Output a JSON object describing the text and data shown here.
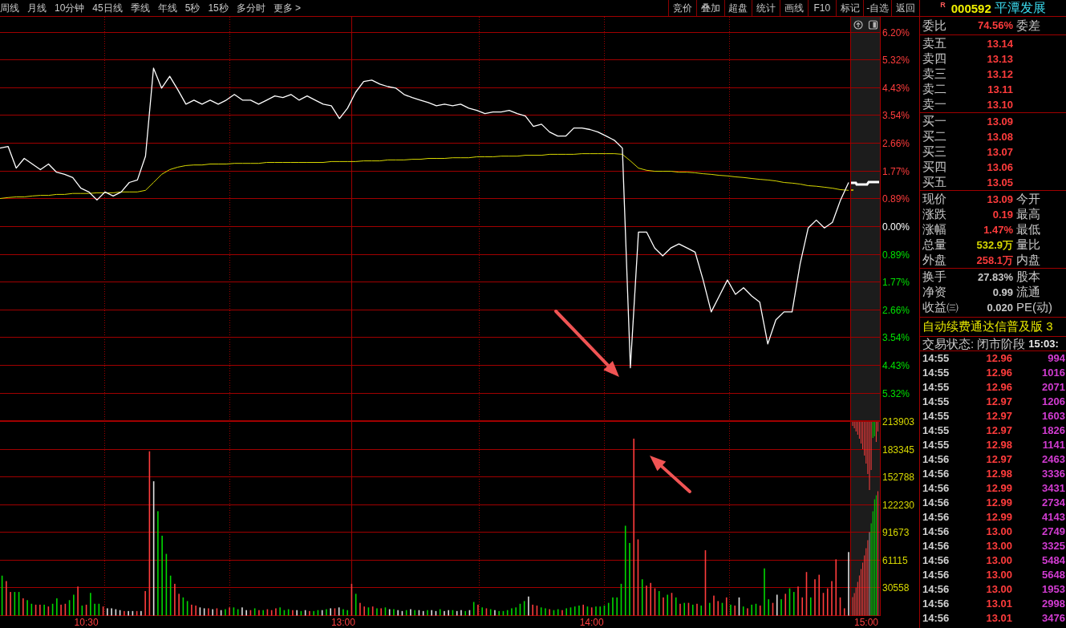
{
  "toolbar": {
    "periods": [
      "周线",
      "月线",
      "10分钟",
      "45日线",
      "季线",
      "年线",
      "5秒",
      "15秒",
      "多分时",
      "更多 >"
    ],
    "buttons": [
      "竞价",
      "叠加",
      "超盘",
      "统计",
      "画线",
      "F10",
      "标记",
      "-自选",
      "返回"
    ]
  },
  "quote_header": {
    "badge": "R",
    "code": "000592",
    "name": "平潭发展"
  },
  "chart": {
    "chart_data": [
      {
        "type": "line",
        "grid": true,
        "tick_labels": "y",
        "ylim": [
          -6.2,
          6.2
        ],
        "yticks": [
          {
            "value": 6.2,
            "label": "6.20%"
          },
          {
            "value": 5.32,
            "label": "5.32%"
          },
          {
            "value": 4.43,
            "label": "4.43%"
          },
          {
            "value": 3.54,
            "label": "3.54%"
          },
          {
            "value": 2.66,
            "label": "2.66%"
          },
          {
            "value": 1.77,
            "label": "1.77%"
          },
          {
            "value": 0.89,
            "label": "0.89%"
          },
          {
            "value": 0,
            "label": "0.00%"
          },
          {
            "value": -0.89,
            "label": "0.89%"
          },
          {
            "value": -1.77,
            "label": "1.77%"
          },
          {
            "value": -2.66,
            "label": "2.66%"
          },
          {
            "value": -3.54,
            "label": "3.54%"
          },
          {
            "value": -4.43,
            "label": "4.43%"
          },
          {
            "value": -5.32,
            "label": "5.32%"
          }
        ],
        "series": [
          {
            "color": "#ffffff",
            "values": [
              2.5,
              2.55,
              1.86,
              2.17,
              1.99,
              1.81,
              1.99,
              1.73,
              1.66,
              1.56,
              1.22,
              1.1,
              0.84,
              1.1,
              0.97,
              1.1,
              1.4,
              1.48,
              2.24,
              5.05,
              4.41,
              4.79,
              4.36,
              3.9,
              4.03,
              3.9,
              4.03,
              3.9,
              4.03,
              4.21,
              4.03,
              4.03,
              3.9,
              4.03,
              4.16,
              4.11,
              4.21,
              4.03,
              4.16,
              4.03,
              3.9,
              3.85,
              3.44,
              3.77,
              4.28,
              4.62,
              4.67,
              4.54,
              4.46,
              4.41,
              4.21,
              4.11,
              4.03,
              3.95,
              3.85,
              3.9,
              3.85,
              3.9,
              3.77,
              3.7,
              3.6,
              3.65,
              3.65,
              3.7,
              3.6,
              3.52,
              3.19,
              3.26,
              3.01,
              2.88,
              2.88,
              3.14,
              3.14,
              3.09,
              3.01,
              2.88,
              2.75,
              2.5,
              -4.51,
              -0.18,
              -0.18,
              -0.69,
              -0.94,
              -0.69,
              -0.56,
              -0.69,
              -0.82,
              -1.71,
              -2.73,
              -2.22,
              -1.71,
              -2.17,
              -1.96,
              -2.22,
              -2.42,
              -3.75,
              -2.98,
              -2.73,
              -2.73,
              -1.2,
              -0.05,
              0.2,
              -0.05,
              0.13,
              0.84,
              1.4
            ]
          },
          {
            "color": "#d8d800",
            "values": [
              0.89,
              0.92,
              0.94,
              0.94,
              0.97,
              0.99,
              0.99,
              1.02,
              1.02,
              1.05,
              1.05,
              1.05,
              1.07,
              1.07,
              1.07,
              1.1,
              1.1,
              1.1,
              1.15,
              1.4,
              1.66,
              1.81,
              1.89,
              1.94,
              1.96,
              1.96,
              1.99,
              1.99,
              1.99,
              2.01,
              2.01,
              2.01,
              2.01,
              2.04,
              2.04,
              2.04,
              2.04,
              2.04,
              2.04,
              2.04,
              2.04,
              2.07,
              2.07,
              2.07,
              2.07,
              2.09,
              2.09,
              2.09,
              2.12,
              2.12,
              2.12,
              2.14,
              2.14,
              2.17,
              2.17,
              2.17,
              2.19,
              2.19,
              2.19,
              2.22,
              2.22,
              2.22,
              2.24,
              2.24,
              2.24,
              2.27,
              2.27,
              2.27,
              2.3,
              2.3,
              2.3,
              2.3,
              2.32,
              2.32,
              2.32,
              2.32,
              2.32,
              2.3,
              2.09,
              1.86,
              1.79,
              1.76,
              1.76,
              1.76,
              1.73,
              1.73,
              1.71,
              1.68,
              1.66,
              1.63,
              1.61,
              1.58,
              1.56,
              1.53,
              1.5,
              1.48,
              1.45,
              1.4,
              1.38,
              1.35,
              1.3,
              1.28,
              1.25,
              1.22,
              1.17,
              1.15
            ]
          }
        ]
      },
      {
        "type": "bar",
        "grid": true,
        "ylim": [
          0,
          213903
        ],
        "yticks": [
          213903,
          183345,
          152788,
          122230,
          91673,
          61115,
          30558
        ],
        "categories": [
          null,
          null,
          null,
          null,
          null,
          null,
          null,
          null,
          null,
          null,
          null,
          null,
          null,
          null,
          null,
          null,
          null,
          null,
          null,
          null,
          "10:30",
          null,
          null,
          null,
          null,
          null,
          null,
          null,
          null,
          null,
          null,
          null,
          null,
          null,
          null,
          null,
          null,
          null,
          null,
          null,
          null,
          null,
          null,
          null,
          null,
          null,
          null,
          null,
          null,
          null,
          null,
          null,
          null,
          null,
          null,
          null,
          null,
          null,
          null,
          null,
          null,
          null,
          null,
          null,
          null,
          null,
          null,
          null,
          null,
          null,
          null,
          null,
          null,
          null,
          null,
          null,
          null,
          null,
          null,
          null,
          null,
          "13:00",
          null,
          null,
          null,
          null,
          null,
          null,
          null,
          null,
          null,
          null,
          null,
          null,
          null,
          null,
          null,
          null,
          null,
          null,
          null,
          null,
          null,
          null,
          null,
          null,
          null,
          null,
          null,
          null,
          null,
          null,
          null,
          null,
          null,
          null,
          null,
          null,
          null,
          null,
          null,
          null,
          null,
          null,
          null,
          null,
          null,
          null,
          null,
          null,
          null,
          null,
          null,
          null,
          null,
          null,
          null,
          null,
          null,
          null,
          "14:00",
          null,
          null,
          null,
          null,
          null,
          null,
          null,
          null,
          null,
          null,
          null,
          null,
          null,
          null,
          null,
          null,
          null,
          null,
          null,
          null,
          null,
          null,
          null,
          null,
          null,
          null,
          null,
          null,
          null,
          null,
          null,
          null,
          null,
          null,
          null,
          null,
          null,
          null,
          null,
          null,
          null,
          null,
          null,
          null,
          null,
          null,
          null,
          null,
          null,
          null,
          null,
          null,
          null,
          null,
          null,
          null,
          null,
          null,
          null,
          null,
          null
        ],
        "values": [
          44000,
          38000,
          26000,
          26000,
          26000,
          19000,
          17000,
          13000,
          12000,
          12000,
          12000,
          10000,
          13000,
          19000,
          12000,
          13000,
          17000,
          23000,
          32000,
          11000,
          12000,
          25000,
          13000,
          13000,
          10000,
          8000,
          8000,
          7000,
          6000,
          5000,
          5000,
          5000,
          5000,
          5000,
          27000,
          181000,
          148000,
          115000,
          88000,
          68000,
          44000,
          35000,
          24000,
          20000,
          16000,
          12000,
          11000,
          9000,
          8000,
          8000,
          7000,
          8000,
          6000,
          7000,
          9000,
          9000,
          7000,
          9000,
          6000,
          6000,
          8000,
          6000,
          6000,
          7000,
          6000,
          8000,
          9000,
          6000,
          7000,
          6000,
          6000,
          5000,
          6000,
          5000,
          5000,
          6000,
          6000,
          7000,
          8000,
          8000,
          9000,
          7000,
          6000,
          35000,
          24000,
          14000,
          10000,
          9000,
          10000,
          8000,
          8000,
          9000,
          7000,
          7000,
          6000,
          5000,
          6000,
          7000,
          6000,
          6000,
          5000,
          6000,
          6000,
          5000,
          7000,
          5000,
          6000,
          6000,
          5000,
          6000,
          5000,
          6000,
          15000,
          12000,
          9000,
          8000,
          7000,
          6000,
          5000,
          5000,
          6000,
          8000,
          9000,
          13000,
          16000,
          21000,
          12000,
          11000,
          9000,
          8000,
          7000,
          6000,
          7000,
          6000,
          8000,
          9000,
          10000,
          11000,
          12000,
          10000,
          9000,
          10000,
          10000,
          11000,
          14000,
          20000,
          20000,
          35000,
          99000,
          80000,
          195000,
          84000,
          40000,
          33000,
          36000,
          30000,
          27000,
          20000,
          23000,
          25000,
          20000,
          13000,
          14000,
          14000,
          12000,
          13000,
          11000,
          72000,
          14000,
          22000,
          16000,
          14000,
          20000,
          12000,
          11000,
          20000,
          10000,
          8000,
          12000,
          13000,
          11000,
          52000,
          18000,
          14000,
          23000,
          18000,
          24000,
          30000,
          26000,
          32000,
          20000,
          48000,
          20000,
          40000,
          45000,
          25000,
          30000,
          38000,
          62000,
          20000,
          8000,
          70000
        ],
        "colors": [
          "#00d800",
          "#ff3c3c",
          "#ff3c3c",
          "#00d800",
          "#00d800",
          "#ff3c3c",
          "#00d800",
          "#00d800",
          "#ff3c3c",
          "#ff3c3c",
          "#00d800",
          "#ff3c3c",
          "#00d800",
          "#00d800",
          "#ff3c3c",
          "#ff3c3c",
          "#00d800",
          "#00d800",
          "#ff3c3c",
          "#00d800",
          "#ff3c3c",
          "#00d800",
          "#00d800",
          "#00d800",
          "#ff3c3c",
          "#e0e0e0",
          "#e0e0e0",
          "#e0e0e0",
          "#e0e0e0",
          "#ff3c3c",
          "#e0e0e0",
          "#e0e0e0",
          "#ff3c3c",
          "#e0e0e0",
          "#ff3c3c",
          "#ff3c3c",
          "#e0e0e0",
          "#00d800",
          "#00d800",
          "#00d800",
          "#00d800",
          "#ff3c3c",
          "#ff3c3c",
          "#00d800",
          "#00d800",
          "#ff3c3c",
          "#ff3c3c",
          "#e0e0e0",
          "#e0e0e0",
          "#ff3c3c",
          "#e0e0e0",
          "#ff3c3c",
          "#e0e0e0",
          "#00d800",
          "#ff3c3c",
          "#00d800",
          "#00d800",
          "#e0e0e0",
          "#e0e0e0",
          "#ff3c3c",
          "#00d800",
          "#ff3c3c",
          "#00d800",
          "#ff3c3c",
          "#ff3c3c",
          "#ff3c3c",
          "#00d800",
          "#00d800",
          "#00d800",
          "#ff3c3c",
          "#e0e0e0",
          "#00d800",
          "#e0e0e0",
          "#ff3c3c",
          "#00d800",
          "#00d800",
          "#e0e0e0",
          "#00d800",
          "#e0e0e0",
          "#ff3c3c",
          "#e0e0e0",
          "#00d800",
          "#00d800",
          "#ff3c3c",
          "#00d800",
          "#ff3c3c",
          "#ff3c3c",
          "#00d800",
          "#ff3c3c",
          "#00d800",
          "#ff3c3c",
          "#00d800",
          "#e0e0e0",
          "#00d800",
          "#e0e0e0",
          "#e0e0e0",
          "#00d800",
          "#e0e0e0",
          "#00d800",
          "#e0e0e0",
          "#e0e0e0",
          "#00d800",
          "#e0e0e0",
          "#e0e0e0",
          "#00d800",
          "#e0e0e0",
          "#e0e0e0",
          "#00d800",
          "#e0e0e0",
          "#e0e0e0",
          "#00d800",
          "#e0e0e0",
          "#00d800",
          "#ff3c3c",
          "#00d800",
          "#ff3c3c",
          "#00d800",
          "#e0e0e0",
          "#00d800",
          "#00d800",
          "#00d800",
          "#00d800",
          "#00d800",
          "#00d800",
          "#00d800",
          "#e0e0e0",
          "#ff3c3c",
          "#ff3c3c",
          "#00d800",
          "#00d800",
          "#ff3c3c",
          "#00d800",
          "#00d800",
          "#ff3c3c",
          "#00d800",
          "#00d800",
          "#00d800",
          "#00d800",
          "#ff3c3c",
          "#00d800",
          "#ff3c3c",
          "#00d800",
          "#00d800",
          "#00d800",
          "#00d800",
          "#00d800",
          "#00d800",
          "#00d800",
          "#00d800",
          "#00d800",
          "#ff3c3c",
          "#ff3c3c",
          "#00d800",
          "#ff3c3c",
          "#ff3c3c",
          "#ff3c3c",
          "#00d800",
          "#ff3c3c",
          "#00d800",
          "#ff3c3c",
          "#00d800",
          "#ff3c3c",
          "#00d800",
          "#ff3c3c",
          "#00d800",
          "#ff3c3c",
          "#00d800",
          "#ff3c3c",
          "#00d800",
          "#ff3c3c",
          "#ff3c3c",
          "#00d800",
          "#ff3c3c",
          "#00d800",
          "#ff3c3c",
          "#e0e0e0",
          "#00d800",
          "#ff3c3c",
          "#00d800",
          "#00d800",
          "#ff3c3c",
          "#00d800",
          "#00d800",
          "#ff3c3c",
          "#e0e0e0",
          "#00d800",
          "#ff3c3c",
          "#00d800",
          "#00d800",
          "#ff3c3c",
          "#ff3c3c",
          "#ff3c3c",
          "#00d800",
          "#ff3c3c",
          "#ff3c3c",
          "#ff3c3c",
          "#ff3c3c",
          "#ff3c3c",
          "#ff3c3c",
          "#ff3c3c",
          "#ff3c3c",
          "#e0e0e0"
        ]
      }
    ],
    "end_time_label": "15:00"
  },
  "quote_panel": {
    "order_ratio": {
      "label": "委比",
      "value": "74.56%",
      "label_2": "委差"
    },
    "asks": [
      {
        "label": "卖五",
        "price": "13.14"
      },
      {
        "label": "卖四",
        "price": "13.13"
      },
      {
        "label": "卖三",
        "price": "13.12"
      },
      {
        "label": "卖二",
        "price": "13.11"
      },
      {
        "label": "卖一",
        "price": "13.10"
      }
    ],
    "bids": [
      {
        "label": "买一",
        "price": "13.09"
      },
      {
        "label": "买二",
        "price": "13.08"
      },
      {
        "label": "买三",
        "price": "13.07"
      },
      {
        "label": "买四",
        "price": "13.06"
      },
      {
        "label": "买五",
        "price": "13.05"
      }
    ],
    "stats": [
      [
        {
          "label": "现价",
          "value": "13.09",
          "color": "#ff3c3c",
          "label_2": "今开"
        },
        {
          "label": "涨跌",
          "value": "0.19",
          "color": "#ff3c3c",
          "label_2": "最高"
        },
        {
          "label": "涨幅",
          "value": "1.47%",
          "color": "#ff3c3c",
          "label_2": "最低"
        },
        {
          "label": "总量",
          "value": "532.9万",
          "color": "#d8d800",
          "label_2": "量比"
        },
        {
          "label": "外盘",
          "value": "258.1万",
          "color": "#ff3c3c",
          "label_2": "内盘"
        }
      ],
      [
        {
          "label": "换手",
          "value": "27.83%",
          "color": "#c8c8c8",
          "label_2": "股本"
        },
        {
          "label": "净资",
          "value": "0.99",
          "color": "#c8c8c8",
          "label_2": "流通"
        },
        {
          "label": "收益㈢",
          "value": "0.020",
          "color": "#c8c8c8",
          "label_2": "PE(动)"
        }
      ]
    ],
    "promo": "自动续费通达信普及版 3",
    "trade_status": {
      "label": "交易状态:",
      "value": "闭市阶段",
      "time": "15:03:"
    },
    "ticks": [
      {
        "time": "14:55",
        "price": "12.96",
        "volume": "994"
      },
      {
        "time": "14:55",
        "price": "12.96",
        "volume": "1016"
      },
      {
        "time": "14:55",
        "price": "12.96",
        "volume": "2071"
      },
      {
        "time": "14:55",
        "price": "12.97",
        "volume": "1206"
      },
      {
        "time": "14:55",
        "price": "12.97",
        "volume": "1603"
      },
      {
        "time": "14:55",
        "price": "12.97",
        "volume": "1826"
      },
      {
        "time": "14:55",
        "price": "12.98",
        "volume": "1141"
      },
      {
        "time": "14:56",
        "price": "12.97",
        "volume": "2463"
      },
      {
        "time": "14:56",
        "price": "12.98",
        "volume": "3336"
      },
      {
        "time": "14:56",
        "price": "12.99",
        "volume": "3431"
      },
      {
        "time": "14:56",
        "price": "12.99",
        "volume": "2734"
      },
      {
        "time": "14:56",
        "price": "12.99",
        "volume": "4143"
      },
      {
        "time": "14:56",
        "price": "13.00",
        "volume": "2749"
      },
      {
        "time": "14:56",
        "price": "13.00",
        "volume": "3325"
      },
      {
        "time": "14:56",
        "price": "13.00",
        "volume": "5484"
      },
      {
        "time": "14:56",
        "price": "13.00",
        "volume": "5648"
      },
      {
        "time": "14:56",
        "price": "13.00",
        "volume": "1953"
      },
      {
        "time": "14:56",
        "price": "13.01",
        "volume": "2998"
      },
      {
        "time": "14:56",
        "price": "13.01",
        "volume": "3476"
      }
    ]
  }
}
